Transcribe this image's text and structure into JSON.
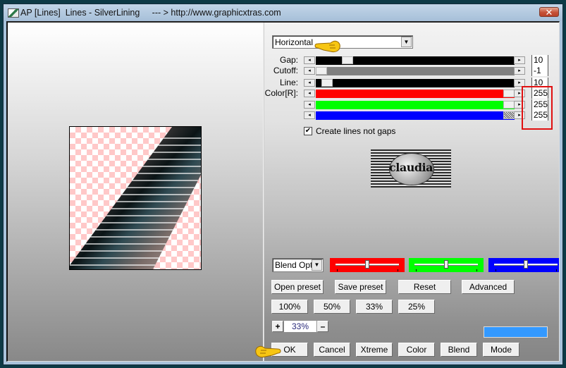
{
  "window": {
    "title": "AP [Lines]  Lines - SilverLining     --- > http://www.graphicxtras.com",
    "close_label": "✕"
  },
  "controls": {
    "direction": {
      "selected": "Horizontal"
    },
    "sliders": [
      {
        "label": "Gap:",
        "value": "10",
        "track_color": "#000000",
        "position": 0.14
      },
      {
        "label": "Cutoff:",
        "value": "-1",
        "track_color": "#808080",
        "position": 0.0
      },
      {
        "label": "Line:",
        "value": "10",
        "track_color": "#000000",
        "position": 0.03
      },
      {
        "label": "Color[R]:",
        "value": "255",
        "track_color": "#ff0000",
        "position": 1.0
      },
      {
        "label": "",
        "value": "255",
        "track_color": "#00ff00",
        "position": 1.0
      },
      {
        "label": "",
        "value": "255",
        "track_color": "#0000ff",
        "position": 1.0
      }
    ],
    "arrow_left": "◂",
    "arrow_right": "▸",
    "checkbox": {
      "label": "Create lines not gaps",
      "checked": true,
      "mark": "✔"
    },
    "logo_text": "claudia",
    "blend": {
      "selected": "Blend Opti",
      "mini_sliders": [
        {
          "color": "#ff0000",
          "position": 0.5
        },
        {
          "color": "#00ff00",
          "position": 0.5
        },
        {
          "color": "#0000ff",
          "position": 0.5
        }
      ]
    },
    "preset_buttons": [
      "Open preset",
      "Save preset",
      "Reset",
      "Advanced"
    ],
    "zoom_buttons": [
      "100%",
      "50%",
      "33%",
      "25%"
    ],
    "zoom": {
      "plus": "+",
      "value": "33%",
      "minus": "–"
    },
    "swatch_color": "#3399ff",
    "action_buttons": [
      "OK",
      "Cancel",
      "Xtreme",
      "Color",
      "Blend",
      "Mode"
    ],
    "dropdown_arrow": "▼"
  }
}
